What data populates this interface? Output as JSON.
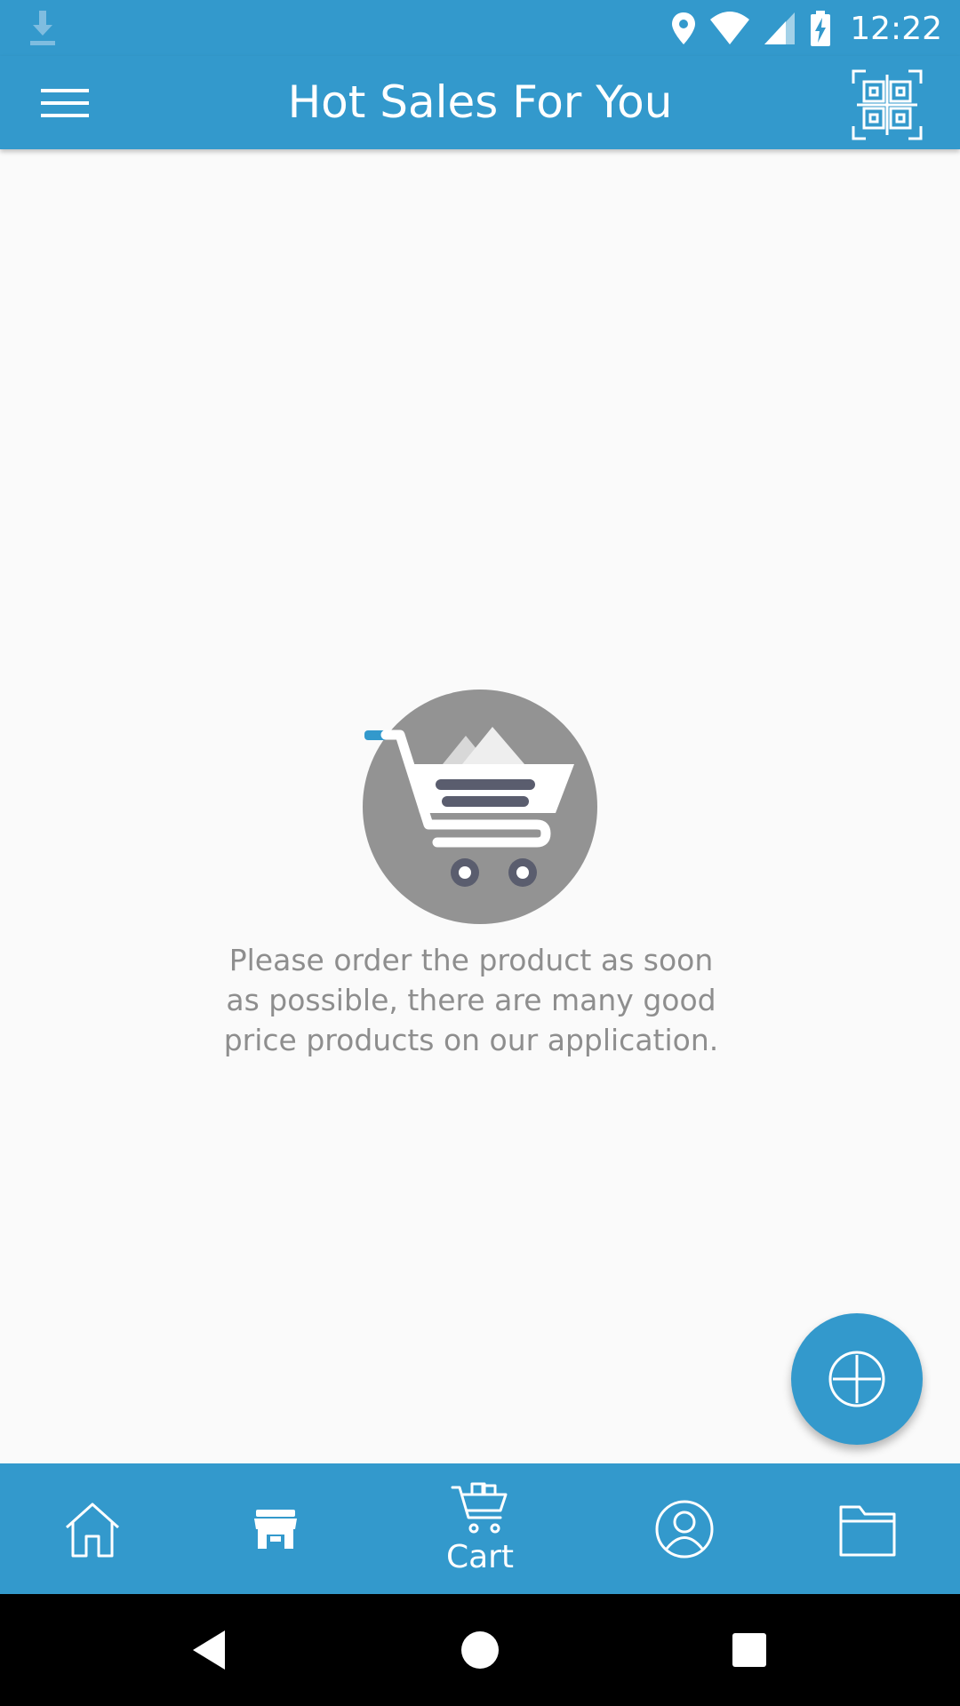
{
  "status_bar": {
    "time": "12:22",
    "icons": [
      "download-icon",
      "location-icon",
      "wifi-icon",
      "signal-icon",
      "battery-charging-icon"
    ]
  },
  "app_bar": {
    "title": "Hot Sales For You",
    "menu_icon": "hamburger-menu-icon",
    "qr_icon": "qr-code-icon"
  },
  "empty_state": {
    "icon": "shopping-cart-icon",
    "message": "Please order the product as soon as possible, there are many good price products on our application."
  },
  "fab": {
    "icon": "add-circle-icon"
  },
  "bottom_nav": {
    "items": [
      {
        "name": "home",
        "icon": "home-icon",
        "label": ""
      },
      {
        "name": "store",
        "icon": "store-icon",
        "label": ""
      },
      {
        "name": "cart",
        "icon": "cart-icon",
        "label": "Cart",
        "active": true
      },
      {
        "name": "account",
        "icon": "account-icon",
        "label": ""
      },
      {
        "name": "folder",
        "icon": "folder-icon",
        "label": ""
      }
    ]
  },
  "system_nav": {
    "icons": [
      "back-icon",
      "home-circle-icon",
      "recents-icon"
    ]
  },
  "colors": {
    "primary": "#3399cc",
    "background": "#fafafa",
    "text_muted": "#8e8e8e"
  }
}
